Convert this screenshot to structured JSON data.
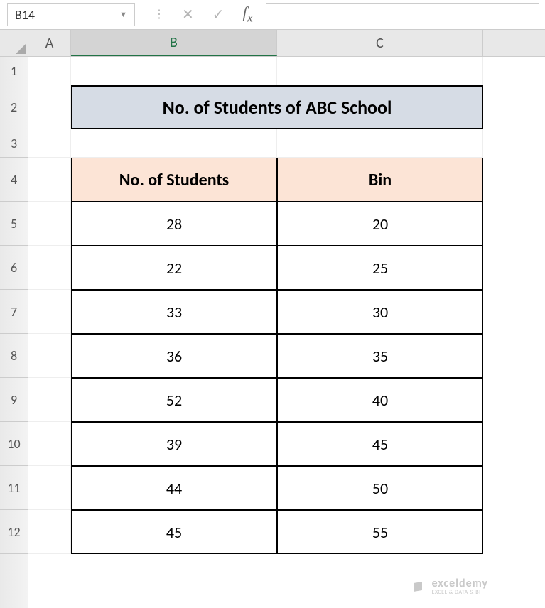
{
  "name_box": "B14",
  "formula_value": "",
  "columns": [
    "A",
    "B",
    "C"
  ],
  "rows": [
    "1",
    "2",
    "3",
    "4",
    "5",
    "6",
    "7",
    "8",
    "9",
    "10",
    "11",
    "12"
  ],
  "title": "No. of Students of ABC School",
  "table": {
    "headers": [
      "No. of Students",
      "Bin"
    ],
    "rows": [
      {
        "students": "28",
        "bin": "20"
      },
      {
        "students": "22",
        "bin": "25"
      },
      {
        "students": "33",
        "bin": "30"
      },
      {
        "students": "36",
        "bin": "35"
      },
      {
        "students": "52",
        "bin": "40"
      },
      {
        "students": "39",
        "bin": "45"
      },
      {
        "students": "44",
        "bin": "50"
      },
      {
        "students": "45",
        "bin": "55"
      }
    ]
  },
  "watermark": {
    "brand": "exceldemy",
    "tag": "EXCEL & DATA & BI"
  },
  "chart_data": {
    "type": "table",
    "title": "No. of Students of ABC School",
    "columns": [
      "No. of Students",
      "Bin"
    ],
    "data": [
      [
        28,
        20
      ],
      [
        22,
        25
      ],
      [
        33,
        30
      ],
      [
        36,
        35
      ],
      [
        52,
        40
      ],
      [
        39,
        45
      ],
      [
        44,
        50
      ],
      [
        45,
        55
      ]
    ]
  }
}
